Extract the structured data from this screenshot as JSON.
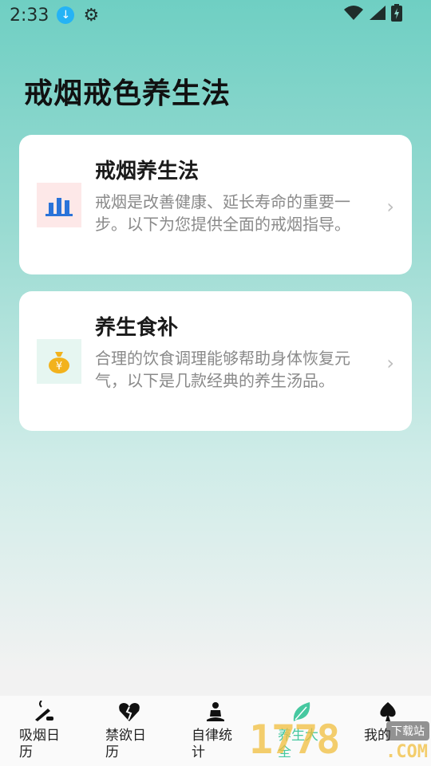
{
  "status_bar": {
    "time": "2:33",
    "icons": [
      "download-icon",
      "gear-icon",
      "wifi-icon",
      "signal-icon",
      "battery-icon"
    ]
  },
  "page": {
    "title": "戒烟戒色养生法"
  },
  "cards": [
    {
      "title": "戒烟养生法",
      "description": "戒烟是改善健康、延长寿命的重要一步。以下为您提供全面的戒烟指导。",
      "icon": "bar-chart-icon",
      "chevron": "›"
    },
    {
      "title": "养生食补",
      "description": "合理的饮食调理能够帮助身体恢复元气，以下是几款经典的养生汤品。",
      "icon": "money-bag-icon",
      "chevron": "›"
    }
  ],
  "bottom_nav": {
    "items": [
      {
        "label": "吸烟日历",
        "icon": "smoking-icon"
      },
      {
        "label": "禁欲日历",
        "icon": "broken-heart-icon"
      },
      {
        "label": "自律统计",
        "icon": "meditation-icon"
      },
      {
        "label": "养生大全",
        "icon": "leaf-icon"
      },
      {
        "label": "我的",
        "icon": "spade-icon"
      }
    ],
    "active_index": 3,
    "active_color": "#46c8a0"
  },
  "watermark": {
    "number": "1778",
    "tag": "下载站",
    "domain": ".COM"
  },
  "colors": {
    "accent": "#46c8a0",
    "download_blue": "#25b3f5"
  }
}
